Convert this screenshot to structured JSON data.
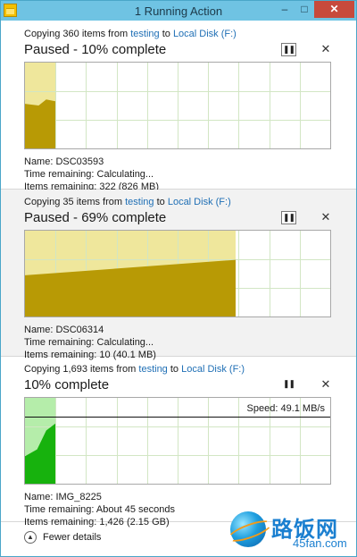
{
  "window": {
    "title": "1 Running Action",
    "controls": {
      "minimize": "–",
      "maximize": "□",
      "close": "✕"
    }
  },
  "operations": [
    {
      "copy": {
        "prefix": "Copying 360 items from ",
        "source": "testing",
        "joiner": " to ",
        "dest": "Local Disk (F:)"
      },
      "status": "Paused - 10% complete",
      "paused": true,
      "progress": 0.1,
      "speed_label": "",
      "colors": {
        "fill": "#b89a05",
        "bg": "#efe79c"
      },
      "details": {
        "name": "Name:  DSC03593",
        "time": "Time remaining:  Calculating...",
        "items": "Items remaining:  322 (826 MB)"
      }
    },
    {
      "copy": {
        "prefix": "Copying 35 items from ",
        "source": "testing",
        "joiner": " to ",
        "dest": "Local Disk (F:)"
      },
      "status": "Paused - 69% complete",
      "paused": true,
      "progress": 0.69,
      "speed_label": "",
      "colors": {
        "fill": "#b89a05",
        "bg": "#efe79c"
      },
      "details": {
        "name": "Name:  DSC06314",
        "time": "Time remaining:  Calculating...",
        "items": "Items remaining:  10 (40.1 MB)"
      }
    },
    {
      "copy": {
        "prefix": "Copying 1,693 items from ",
        "source": "testing",
        "joiner": " to ",
        "dest": "Local Disk (F:)"
      },
      "status": "10% complete",
      "paused": false,
      "progress": 0.1,
      "speed_label": "Speed: 49.1 MB/s",
      "colors": {
        "fill": "#17b20d",
        "bg": "#b5edaa"
      },
      "details": {
        "name": "Name:  IMG_8225",
        "time": "Time remaining:  About 45 seconds",
        "items": "Items remaining:  1,426 (2.15 GB)"
      }
    }
  ],
  "controls": {
    "pause_glyph": "❚❚",
    "cancel_glyph": "✕"
  },
  "footer": {
    "fewer_details_label": "Fewer details",
    "chevron_glyph": "▲"
  },
  "watermark": {
    "text_cn": "路饭网",
    "text_en": "45fan.com"
  }
}
